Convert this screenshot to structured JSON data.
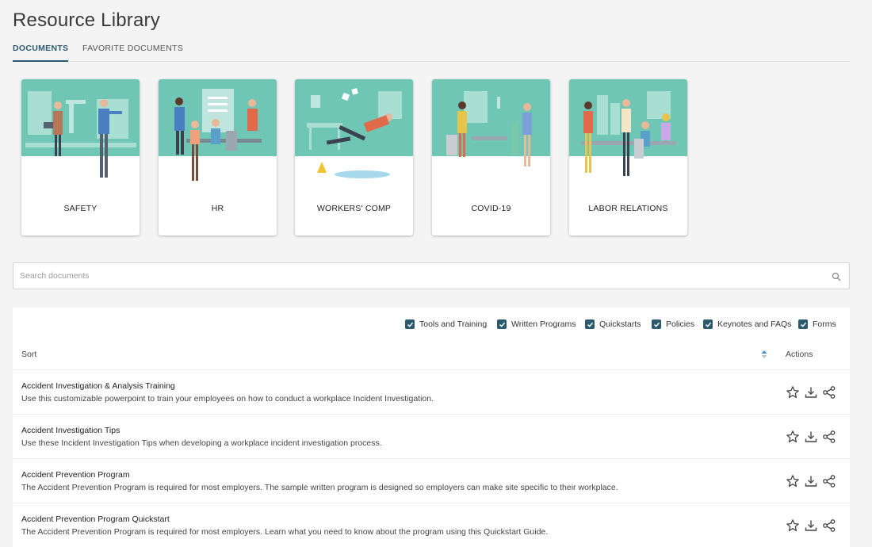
{
  "page": {
    "title": "Resource Library"
  },
  "tabs": [
    {
      "label": "DOCUMENTS",
      "active": true
    },
    {
      "label": "FAVORITE DOCUMENTS",
      "active": false
    }
  ],
  "categories": [
    {
      "label": "SAFETY"
    },
    {
      "label": "HR"
    },
    {
      "label": "WORKERS' COMP"
    },
    {
      "label": "COVID-19"
    },
    {
      "label": "LABOR RELATIONS"
    }
  ],
  "search": {
    "placeholder": "Search documents",
    "value": ""
  },
  "filters": [
    {
      "label": "Tools and Training",
      "checked": true
    },
    {
      "label": "Written Programs",
      "checked": true
    },
    {
      "label": "Quickstarts",
      "checked": true
    },
    {
      "label": "Policies",
      "checked": true
    },
    {
      "label": "Keynotes and FAQs",
      "checked": true
    },
    {
      "label": "Forms",
      "checked": true
    }
  ],
  "table": {
    "sort_label": "Sort",
    "actions_label": "Actions",
    "rows": [
      {
        "title": "Accident Investigation & Analysis Training",
        "description": "Use this customizable powerpoint to train your employees on how to conduct a workplace Incident Investigation."
      },
      {
        "title": "Accident Investigation Tips",
        "description": "Use these Incident Investigation Tips when developing a workplace incident investigation process."
      },
      {
        "title": "Accident Prevention Program",
        "description": "The Accident Prevention Program is required for most employers. The sample written program is designed so employers can make site specific to their workplace."
      },
      {
        "title": "Accident Prevention Program Quickstart",
        "description": "The Accident Prevention Program is required for most employers. Learn what you need to know about the program using this Quickstart Guide."
      }
    ]
  },
  "icons": {
    "favorite": "star-icon",
    "download": "download-icon",
    "share": "share-icon",
    "search": "search-icon",
    "sort": "sort-arrows-icon"
  },
  "colors": {
    "accent": "#2b5a6e",
    "illustration_bg": "#6fc6b4",
    "page_bg": "#f4f4f4"
  }
}
